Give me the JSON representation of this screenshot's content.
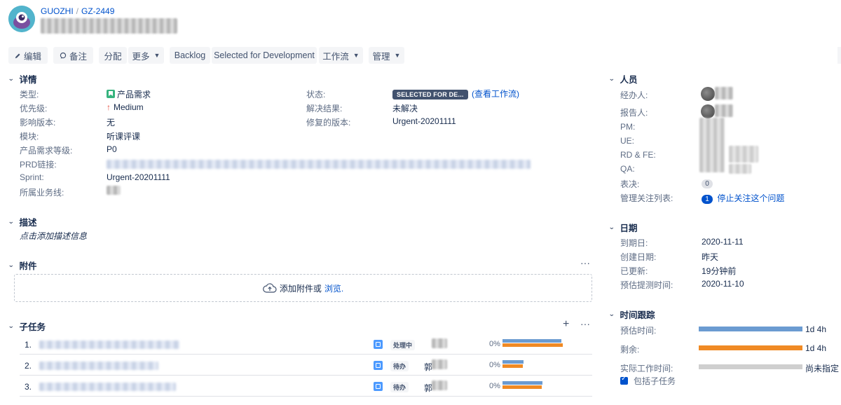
{
  "header": {
    "project": "GUOZHI",
    "issue_key": "GZ-2449"
  },
  "toolbar": {
    "edit": "编辑",
    "comment": "备注",
    "assign": "分配",
    "more": "更多",
    "backlog": "Backlog",
    "selected_dev": "Selected for Development",
    "workflow": "工作流",
    "admin": "管理"
  },
  "details": {
    "title": "详情",
    "type_label": "类型:",
    "type_value": "产品需求",
    "priority_label": "优先级:",
    "priority_value": "Medium",
    "affects_label": "影响版本:",
    "affects_value": "无",
    "module_label": "模块:",
    "module_value": "听课评课",
    "level_label": "产品需求等级:",
    "level_value": "P0",
    "prd_label": "PRD链接:",
    "sprint_label": "Sprint:",
    "sprint_value": "Urgent-20201111",
    "biz_label": "所属业务线:",
    "status_label": "状态:",
    "status_value": "SELECTED FOR DE...",
    "view_workflow": "(查看工作流)",
    "resolution_label": "解决结果:",
    "resolution_value": "未解决",
    "fix_label": "修复的版本:",
    "fix_value": "Urgent-20201111"
  },
  "description": {
    "title": "描述",
    "placeholder": "点击添加描述信息"
  },
  "attachments": {
    "title": "附件",
    "drop_text": "添加附件或",
    "browse": "浏览."
  },
  "subtasks": {
    "title": "子任务",
    "rows": [
      {
        "num": "1.",
        "status": "处理中",
        "assignee_initial": "",
        "pct": "0%",
        "est": 0.95,
        "rem": 0.98
      },
      {
        "num": "2.",
        "status": "待办",
        "assignee_initial": "郭",
        "pct": "0%",
        "est": 0.35,
        "rem": 0.34
      },
      {
        "num": "3.",
        "status": "待办",
        "assignee_initial": "郭",
        "pct": "0%",
        "est": 0.68,
        "rem": 0.66
      }
    ]
  },
  "people": {
    "title": "人员",
    "assignee_label": "经办人:",
    "reporter_label": "报告人:",
    "pm_label": "PM:",
    "ue_label": "UE:",
    "rd_label": "RD & FE:",
    "qa_label": "QA:",
    "votes_label": "表决:",
    "votes_value": "0",
    "watchers_label": "管理关注列表:",
    "watchers_count": "1",
    "stop_watching": "停止关注这个问题"
  },
  "dates": {
    "title": "日期",
    "due_label": "到期日:",
    "due_value": "2020-11-11",
    "created_label": "创建日期:",
    "created_value": "昨天",
    "updated_label": "已更新:",
    "updated_value": "19分钟前",
    "est_test_label": "预估提测时间:",
    "est_test_value": "2020-11-10"
  },
  "time_tracking": {
    "title": "时间跟踪",
    "estimated_label": "预估时间:",
    "estimated_value": "1d 4h",
    "remaining_label": "剩余:",
    "remaining_value": "1d 4h",
    "logged_label": "实际工作时间:",
    "logged_value": "尚未指定",
    "include_subtasks": "包括子任务"
  },
  "colors": {
    "estimated": "#6b9bd1",
    "remaining": "#f08a24",
    "logged": "#cfcfcf",
    "status_badge": "#42526e"
  }
}
